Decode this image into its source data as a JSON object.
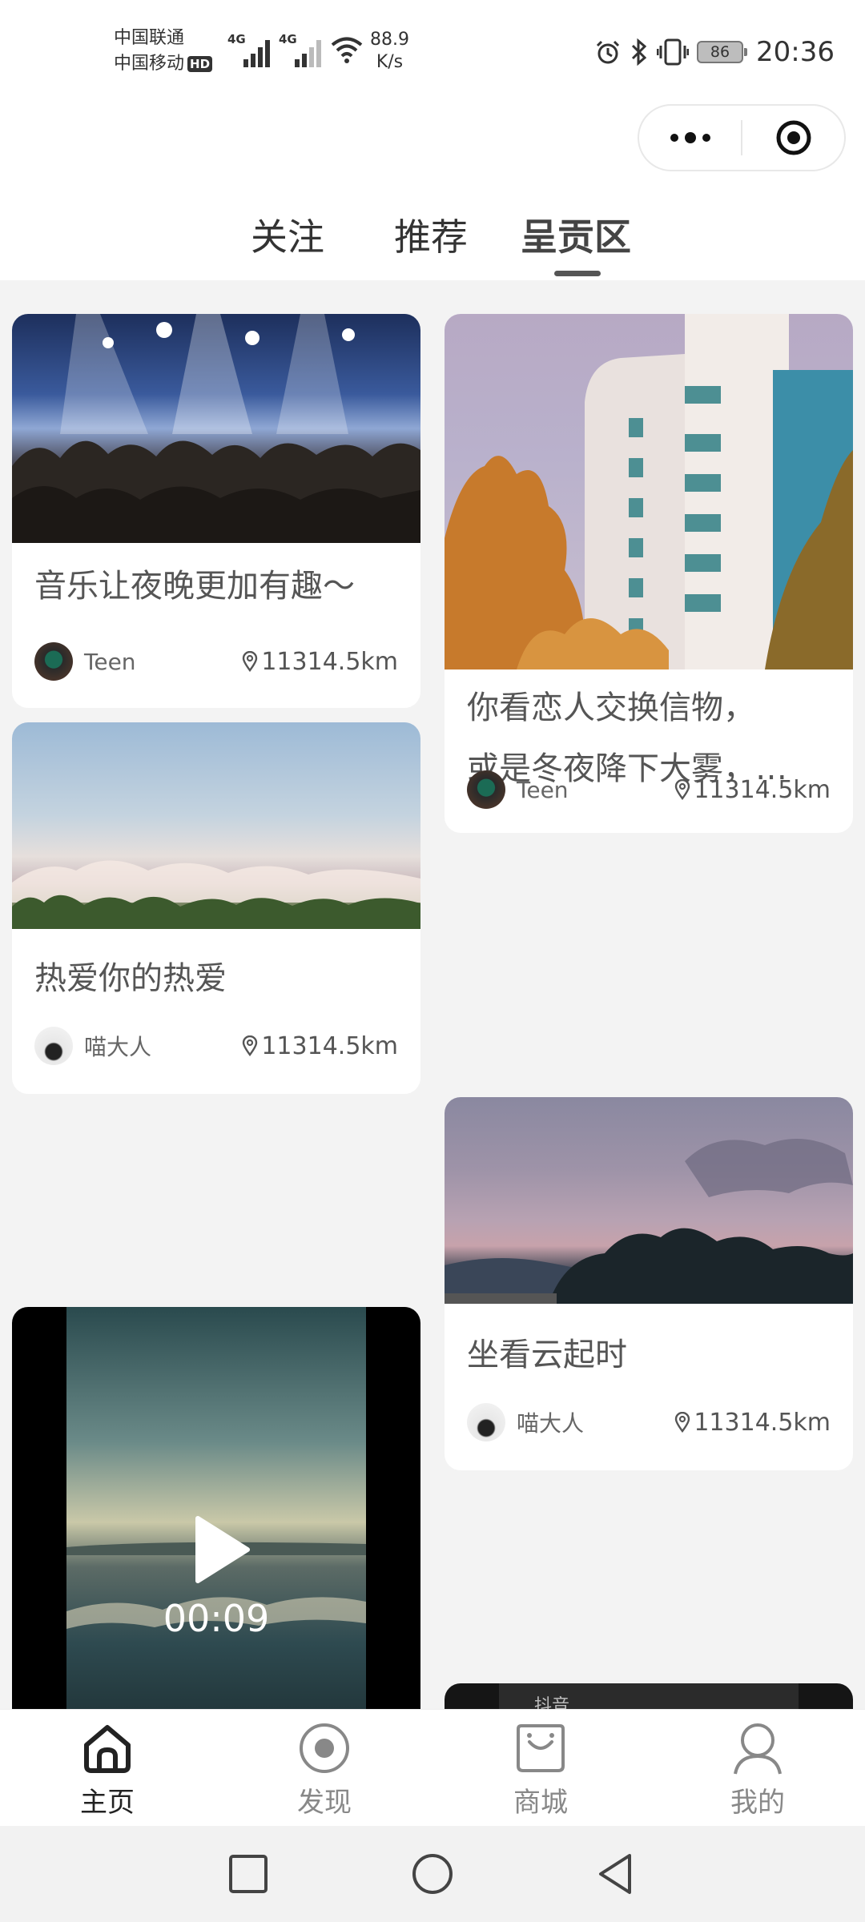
{
  "status_bar": {
    "carrier1": "中国联通",
    "carrier2": "中国移动",
    "hd": "HD",
    "sig1_label": "4G",
    "sig2_label": "4G",
    "speed_value": "88.9",
    "speed_unit": "K/s",
    "battery": "86",
    "time": "20:36",
    "icons": [
      "alarm-icon",
      "bluetooth-icon",
      "vibrate-icon",
      "battery-icon"
    ]
  },
  "capsule": {
    "icons": [
      "more-dots-icon",
      "target-close-icon"
    ]
  },
  "tabs": [
    {
      "label": "关注"
    },
    {
      "label": "推荐"
    },
    {
      "label": "呈贡区",
      "active": true
    }
  ],
  "feed": {
    "left": [
      {
        "title": "音乐让夜晚更加有趣～",
        "author": "Teen",
        "distance": "11314.5km",
        "image": "concert-photo"
      },
      {
        "title": "热爱你的热爱",
        "author": "喵大人",
        "distance": "11314.5km",
        "image": "sky-clouds-photo"
      },
      {
        "type": "video",
        "duration": "00:09",
        "image": "sea-sunset-video"
      }
    ],
    "right": [
      {
        "title_line1": "你看恋人交换信物，",
        "title_line2": "或是冬夜降下大雾，…",
        "author": "Teen",
        "distance": "11314.5km",
        "image": "building-autumn-photo"
      },
      {
        "title": "坐看云起时",
        "author": "喵大人",
        "distance": "11314.5km",
        "image": "dusk-trees-photo"
      }
    ],
    "partial_label": "抖音"
  },
  "bottom_nav": [
    {
      "label": "主页",
      "icon": "home-icon",
      "active": true
    },
    {
      "label": "发现",
      "icon": "discover-icon"
    },
    {
      "label": "商城",
      "icon": "shop-bag-icon"
    },
    {
      "label": "我的",
      "icon": "profile-icon"
    }
  ],
  "colors": {
    "feed_background": "#f3f3f3",
    "active_text": "#222222",
    "inactive_text": "#888888"
  }
}
